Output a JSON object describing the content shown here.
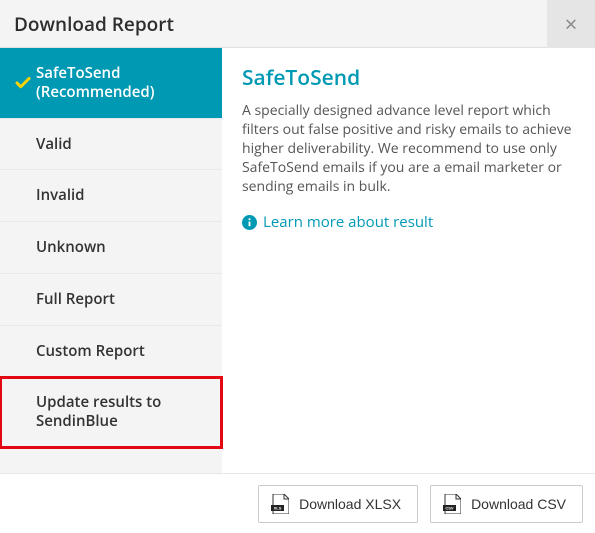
{
  "header": {
    "title": "Download Report"
  },
  "sidebar": {
    "items": [
      {
        "label": "SafeToSend (Recommended)",
        "active": true
      },
      {
        "label": "Valid",
        "active": false
      },
      {
        "label": "Invalid",
        "active": false
      },
      {
        "label": "Unknown",
        "active": false
      },
      {
        "label": "Full Report",
        "active": false
      },
      {
        "label": "Custom Report",
        "active": false
      },
      {
        "label": "Update results to SendinBlue",
        "active": false,
        "highlighted": true
      }
    ]
  },
  "main": {
    "title": "SafeToSend",
    "description": "A specially designed advance level report which filters out false positive and risky emails to achieve higher deliverability. We recommend to use only SafeToSend emails if you are a email marketer or sending emails in bulk.",
    "learn_more": "Learn more about result"
  },
  "footer": {
    "xlsx_label": "Download XLSX",
    "csv_label": "Download CSV"
  }
}
